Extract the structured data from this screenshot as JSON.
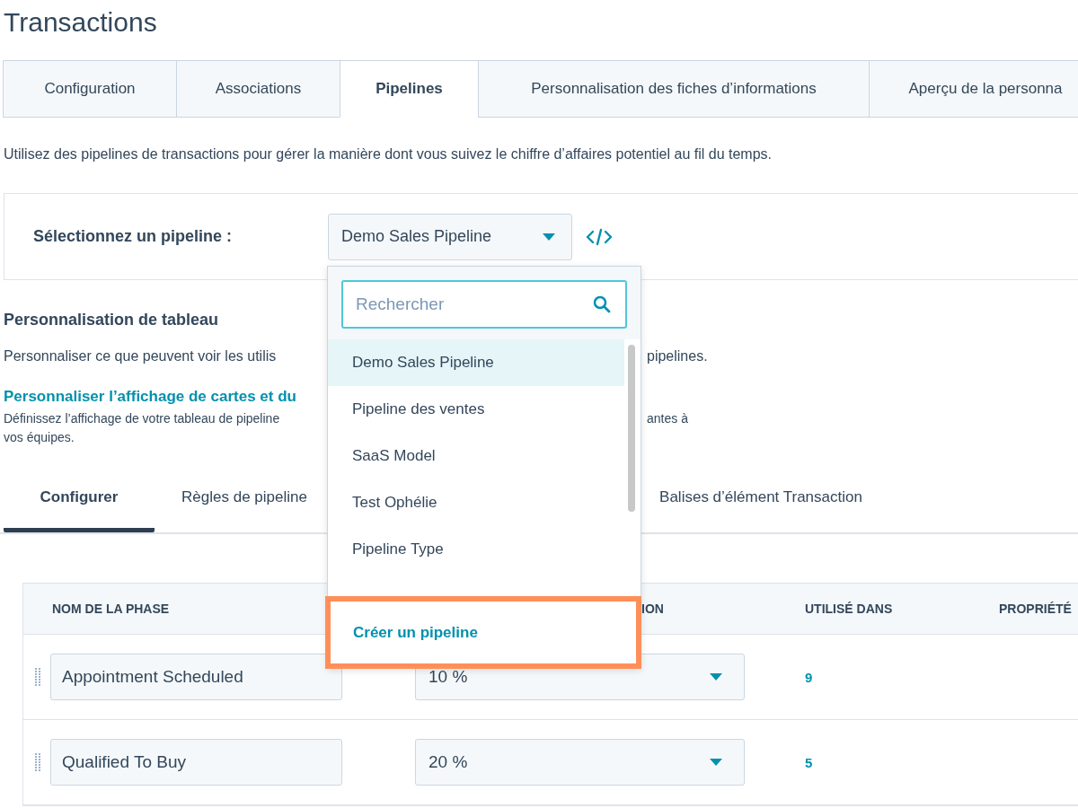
{
  "title": "Transactions",
  "tabs": [
    {
      "label": "Configuration",
      "selected": false
    },
    {
      "label": "Associations",
      "selected": false
    },
    {
      "label": "Pipelines",
      "selected": true
    },
    {
      "label": "Personnalisation des fiches d’informations",
      "selected": false
    },
    {
      "label": "Aperçu de la personna",
      "selected": false
    }
  ],
  "description": "Utilisez des pipelines de transactions pour gérer la manière dont vous suivez le chiffre d’affaires potentiel au fil du temps.",
  "pipeline_select": {
    "label": "Sélectionnez un pipeline :",
    "value": "Demo Sales Pipeline"
  },
  "dropdown": {
    "search_placeholder": "Rechercher",
    "options": [
      {
        "label": "Demo Sales Pipeline",
        "selected": true
      },
      {
        "label": "Pipeline des ventes",
        "selected": false
      },
      {
        "label": "SaaS Model",
        "selected": false
      },
      {
        "label": "Test Ophélie",
        "selected": false
      },
      {
        "label": "Pipeline Type",
        "selected": false
      }
    ],
    "create_label": "Créer un pipeline"
  },
  "table_customization": {
    "heading": "Personnalisation de tableau",
    "text_left": "Personnaliser ce que peuvent voir les utilis",
    "text_right": "pipelines.",
    "link": "Personnaliser l’affichage de cartes et du",
    "link_desc_left": "Définissez l’affichage de votre tableau de pipeline",
    "link_desc_right": "antes à",
    "link_desc_line2": "vos équipes."
  },
  "sub_tabs": [
    {
      "label": "Configurer",
      "selected": true
    },
    {
      "label": "Règles de pipeline",
      "selected": false
    },
    {
      "label": "Balises d’élément Transaction",
      "selected": false
    }
  ],
  "table": {
    "columns": [
      "NOM DE LA PHASE",
      "ION",
      "UTILISÉ DANS",
      "PROPRIÉTÉ"
    ],
    "rows": [
      {
        "name": "Appointment Scheduled",
        "probability": "10 %",
        "used_in": "9"
      },
      {
        "name": "Qualified To Buy",
        "probability": "20 %",
        "used_in": "5"
      }
    ]
  }
}
